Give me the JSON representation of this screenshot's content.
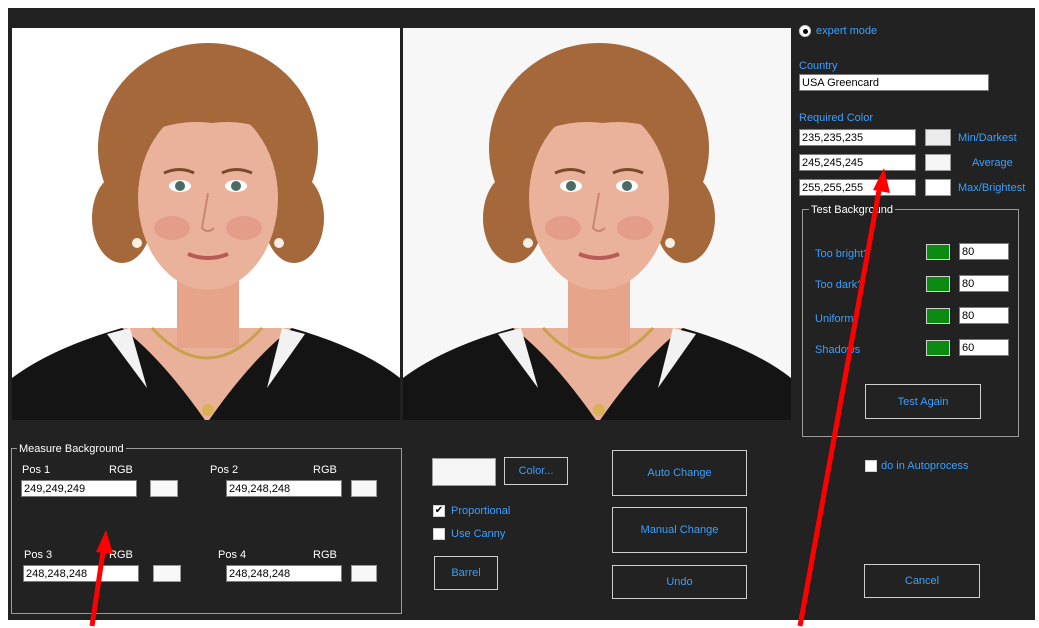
{
  "expert_mode": {
    "label": "expert mode"
  },
  "country": {
    "label": "Country",
    "value": "USA Greencard"
  },
  "required_color": {
    "label": "Required Color",
    "rows": [
      {
        "value": "235,235,235",
        "label": "Min/Darkest",
        "swatch": "#ebebeb"
      },
      {
        "value": "245,245,245",
        "label": "Average",
        "swatch": "#f5f5f5"
      },
      {
        "value": "255,255,255",
        "label": "Max/Brightest",
        "swatch": "#ffffff"
      }
    ]
  },
  "test_background": {
    "title": "Test Background",
    "rows": [
      {
        "label": "Too bright?",
        "value": "80"
      },
      {
        "label": "Too dark?",
        "value": "80"
      },
      {
        "label": "Uniform",
        "value": "80"
      },
      {
        "label": "Shadows",
        "value": "60"
      }
    ],
    "test_again": "Test Again"
  },
  "autoprocess": {
    "label": "do in Autoprocess"
  },
  "cancel": "Cancel",
  "measure": {
    "title": "Measure Background",
    "positions": [
      {
        "label": "Pos 1",
        "rgb": "RGB",
        "value": "249,249,249"
      },
      {
        "label": "Pos 2",
        "rgb": "RGB",
        "value": "249,248,248"
      },
      {
        "label": "Pos 3",
        "rgb": "RGB",
        "value": "248,248,248"
      },
      {
        "label": "Pos 4",
        "rgb": "RGB",
        "value": "248,248,248"
      }
    ]
  },
  "color_button": "Color...",
  "proportional": "Proportional",
  "use_canny": "Use Canny",
  "barrel": "Barrel",
  "auto_change": "Auto Change",
  "manual_change": "Manual Change",
  "undo": "Undo",
  "colors": {
    "accent": "#3aa0ff",
    "background": "#222222",
    "indicator": "#0a8c12",
    "arrow": "#ff0000"
  }
}
